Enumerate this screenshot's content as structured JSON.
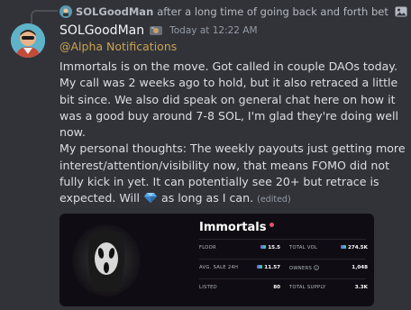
{
  "reply": {
    "author": "SOLGoodMan",
    "preview": "after a long time of going back and forth bet",
    "has_image_attachment": true
  },
  "message": {
    "author": "SOLGoodMan",
    "timestamp": "Today at 12:22 AM",
    "mention": "@Alpha Notifications",
    "paragraph1": "Immortals is on the move. Got called in couple DAOs today. My call was 2 weeks ago to hold, but it also retraced a little bit since. We also did speak on general chat here on how it was a good buy around 7-8 SOL, I'm glad they're doing well now.",
    "paragraph2_before": "My personal thoughts: The weekly payouts just getting more interest/attention/visibility now, that means FOMO did not fully kick in yet. It can potentially see 20+ but retrace is expected. Will ",
    "paragraph2_emoji": "gem-icon",
    "paragraph2_after": " as long as I can.",
    "edited_label": "(edited)"
  },
  "embed": {
    "collection_name": "Immortals",
    "stats": [
      {
        "label": "FLOOR",
        "value": "15.5",
        "currency": true
      },
      {
        "label": "TOTAL VOL",
        "value": "274.5K",
        "currency": true
      },
      {
        "label": "AVG. SALE 24H",
        "value": "11.57",
        "currency": true
      },
      {
        "label": "OWNERS",
        "value": "1,048",
        "currency": false,
        "info_icon": true
      },
      {
        "label": "LISTED",
        "value": "80",
        "currency": false
      },
      {
        "label": "TOTAL SUPPLY",
        "value": "3.3K",
        "currency": false
      }
    ]
  },
  "colors": {
    "background": "#323339",
    "mention": "#c9a34e",
    "text": "#dbdee1",
    "muted": "#949ba4",
    "embed_bg": "#0f0d13",
    "live_dot": "#e6506e"
  }
}
